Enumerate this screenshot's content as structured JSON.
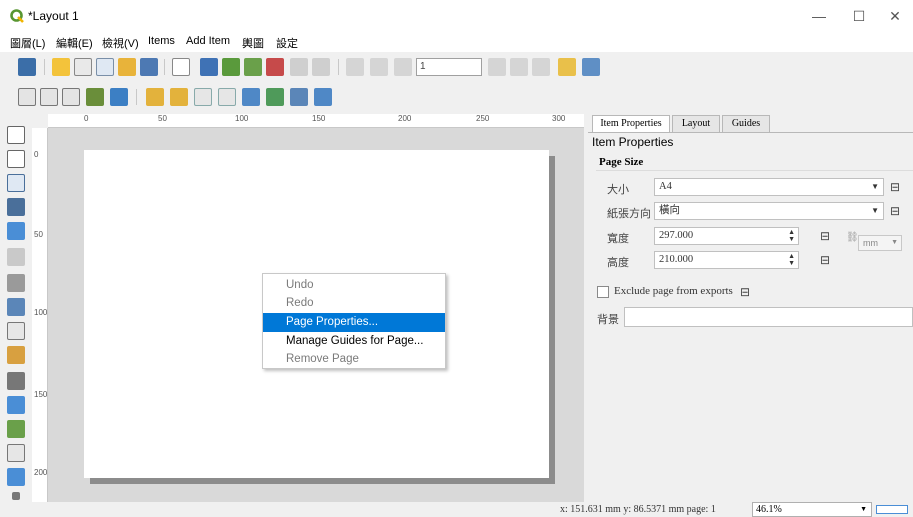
{
  "window": {
    "title": "*Layout 1",
    "minimize": "—",
    "maximize": "☐",
    "close": "✕"
  },
  "menu": [
    {
      "label": "圖層(L)",
      "key": "menu-layout"
    },
    {
      "label": "編輯(E)",
      "key": "menu-edit"
    },
    {
      "label": "檢視(V)",
      "key": "menu-view"
    },
    {
      "label": "Items",
      "key": "menu-items"
    },
    {
      "label": "Add Item",
      "key": "menu-add-item"
    },
    {
      "label": "輿圖",
      "key": "menu-atlas"
    },
    {
      "label": "設定",
      "key": "menu-settings"
    }
  ],
  "toolbar": {
    "page_field_value": "1"
  },
  "ruler": {
    "top_labels": [
      "0",
      "50",
      "100",
      "150",
      "200",
      "250",
      "300"
    ],
    "left_labels": [
      "0",
      "50",
      "100",
      "150",
      "200"
    ]
  },
  "context_menu": {
    "items": [
      {
        "label": "Undo",
        "state": "disabled"
      },
      {
        "label": "Redo",
        "state": "disabled"
      },
      {
        "label": "Page Properties...",
        "state": "active"
      },
      {
        "label": "Manage Guides for Page...",
        "state": "enabled"
      },
      {
        "label": "Remove Page",
        "state": "disabled"
      }
    ]
  },
  "panel": {
    "tabs": [
      "Item Properties",
      "Layout",
      "Guides"
    ],
    "active_tab": "Item Properties",
    "title": "Item Properties",
    "page_size": {
      "section_title": "Page Size",
      "size_label": "大小",
      "size_value": "A4",
      "orientation_label": "紙張方向",
      "orientation_value": "橫向",
      "width_label": "寬度",
      "width_value": "297.000",
      "height_label": "高度",
      "height_value": "210.000",
      "unit": "mm"
    },
    "exclude_label": "Exclude page from exports",
    "exclude_checked": false,
    "background_label": "背景"
  },
  "status": {
    "coords": "x: 151.631 mm y: 86.5371 mm page: 1",
    "zoom": "46.1%"
  },
  "colors": {
    "selection": "#0078d7",
    "canvas": "#d9d9d9",
    "qgis_green": "#589632"
  }
}
